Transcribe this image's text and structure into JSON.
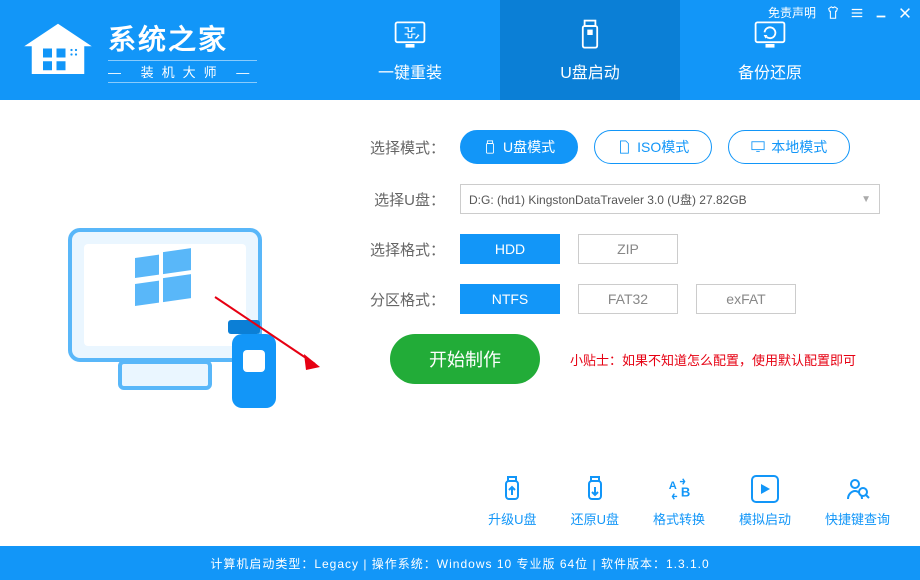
{
  "header": {
    "title": "系统之家",
    "subtitle": "装机大师",
    "disclaimer": "免责声明"
  },
  "nav": {
    "tabs": [
      {
        "label": "一键重装"
      },
      {
        "label": "U盘启动"
      },
      {
        "label": "备份还原"
      }
    ]
  },
  "config": {
    "mode_label": "选择模式：",
    "modes": [
      {
        "label": "U盘模式"
      },
      {
        "label": "ISO模式"
      },
      {
        "label": "本地模式"
      }
    ],
    "usb_label": "选择U盘：",
    "usb_value": "D:G: (hd1) KingstonDataTraveler 3.0 (U盘) 27.82GB",
    "disk_fmt_label": "选择格式：",
    "disk_fmts": [
      {
        "label": "HDD"
      },
      {
        "label": "ZIP"
      }
    ],
    "part_fmt_label": "分区格式：",
    "part_fmts": [
      {
        "label": "NTFS"
      },
      {
        "label": "FAT32"
      },
      {
        "label": "exFAT"
      }
    ],
    "start_btn": "开始制作",
    "tip": "小贴士：如果不知道怎么配置，使用默认配置即可"
  },
  "tools": [
    {
      "label": "升级U盘"
    },
    {
      "label": "还原U盘"
    },
    {
      "label": "格式转换"
    },
    {
      "label": "模拟启动"
    },
    {
      "label": "快捷键查询"
    }
  ],
  "status": "计算机启动类型：Legacy | 操作系统：Windows 10 专业版 64位 | 软件版本：1.3.1.0"
}
